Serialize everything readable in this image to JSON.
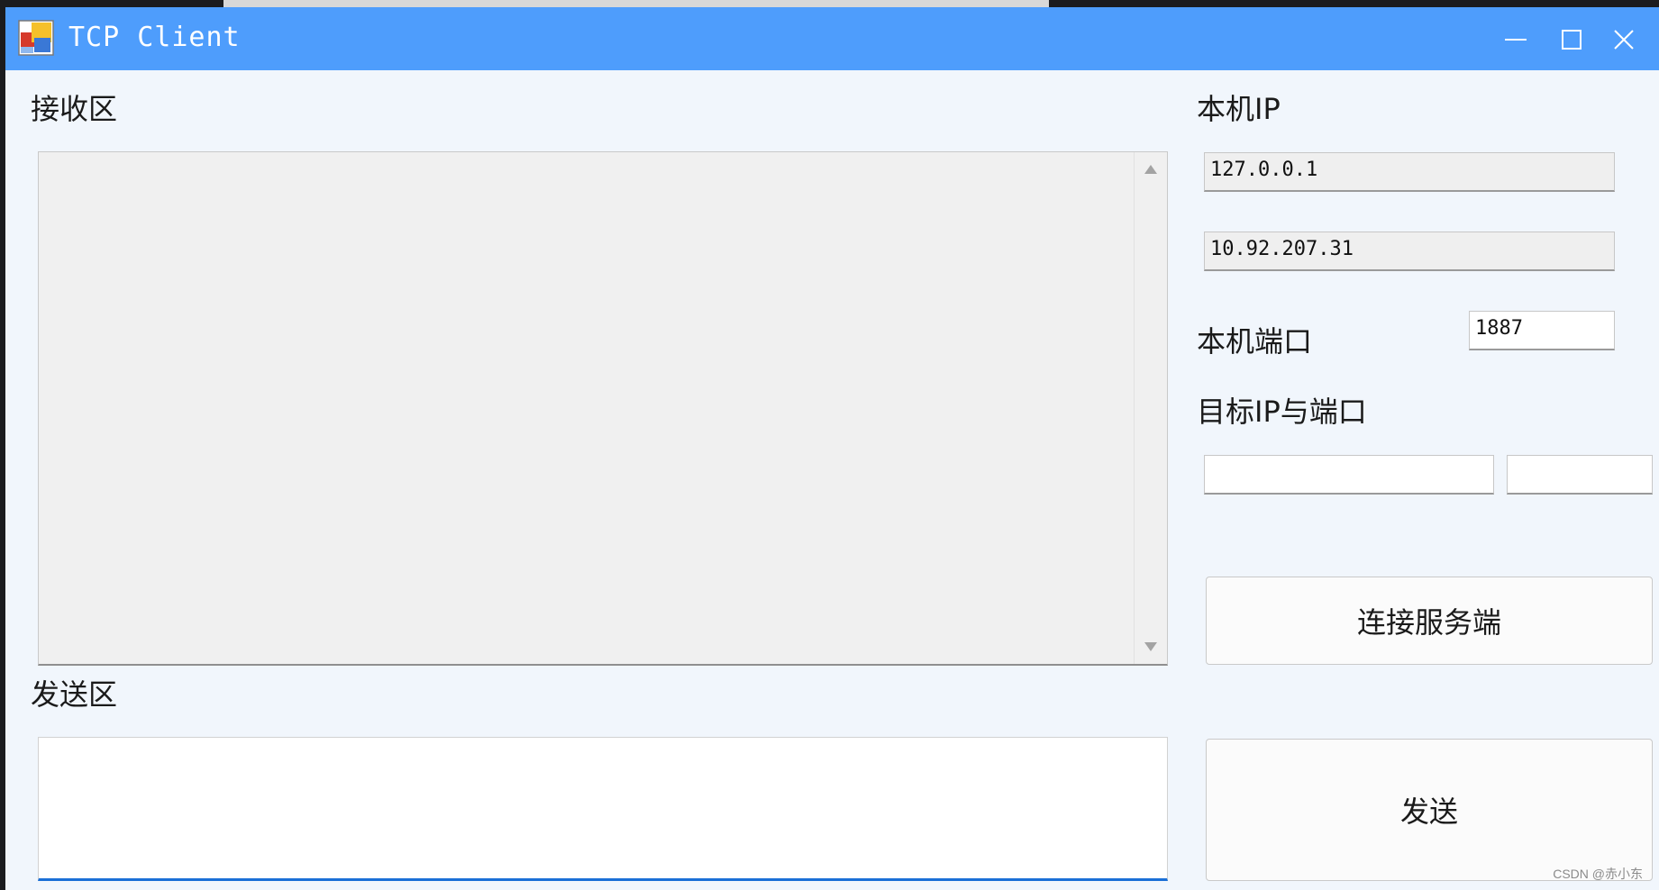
{
  "window": {
    "title": "TCP Client",
    "icon": "app-window-icon",
    "controls": {
      "minimize": "minimize-icon",
      "maximize": "maximize-icon",
      "close": "close-icon"
    }
  },
  "receive": {
    "label": "接收区",
    "content": ""
  },
  "send": {
    "label": "发送区",
    "content": ""
  },
  "local_ip": {
    "label": "本机IP",
    "values": [
      "127.0.0.1",
      "10.92.207.31"
    ]
  },
  "local_port": {
    "label": "本机端口",
    "value": "1887"
  },
  "target": {
    "label": "目标IP与端口",
    "ip": "",
    "port": ""
  },
  "buttons": {
    "connect": "连接服务端",
    "send": "发送"
  },
  "watermark": "CSDN @赤小东",
  "colors": {
    "titlebar": "#4e9dfc",
    "window_bg": "#f1f6fc",
    "focus_underline": "#1a6fd6"
  }
}
